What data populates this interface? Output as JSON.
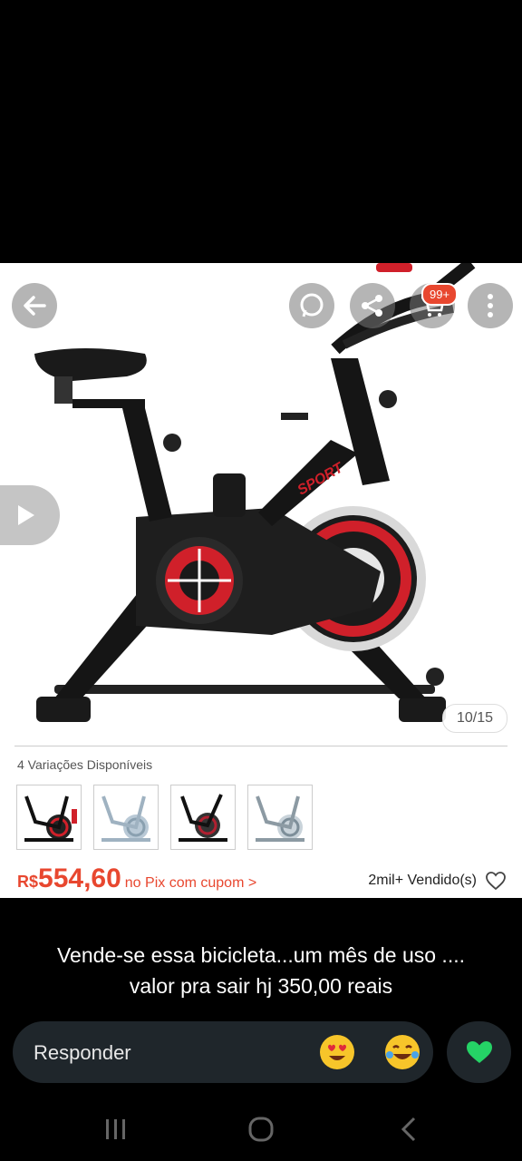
{
  "product": {
    "image_counter": "10/15",
    "cart_badge": "99+",
    "variants_label": "4 Variações Disponíveis",
    "currency": "R$",
    "price": "554,60",
    "pix_text": "no Pix com cupom >",
    "sold_text": "2mil+ Vendido(s)",
    "bike_brand_text": "SPORT"
  },
  "message": {
    "line1": "Vende-se essa bicicleta...um mês de uso ....",
    "line2": "valor pra sair hj 350,00 reais"
  },
  "reply": {
    "placeholder": "Responder",
    "emoji1": "heart-eyes-emoji",
    "emoji2": "tears-of-joy-emoji"
  },
  "colors": {
    "accent": "#e8472f",
    "heart": "#25d366"
  }
}
